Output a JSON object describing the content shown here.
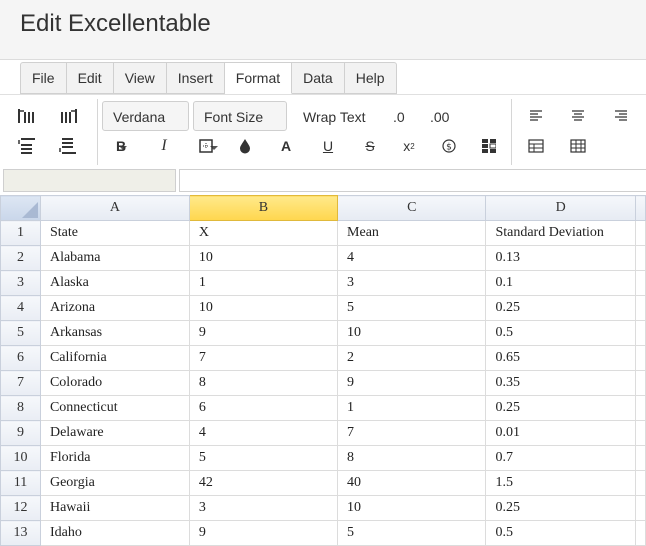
{
  "app": {
    "title": "Edit Excellentable"
  },
  "menu": {
    "items": [
      "File",
      "Edit",
      "View",
      "Insert",
      "Format",
      "Data",
      "Help"
    ],
    "active": "Format"
  },
  "toolbar": {
    "font_family": "Verdana",
    "font_size": "Font Size",
    "wrap_text": "Wrap Text",
    "decrease_decimal": ".0",
    "increase_decimal": ".00"
  },
  "formula_bar": {
    "cell_ref": "",
    "value": ""
  },
  "sheet": {
    "columns": [
      "A",
      "B",
      "C",
      "D"
    ],
    "selected_column": "B",
    "rows": [
      {
        "n": "1",
        "cells": [
          "State",
          "X",
          "Mean",
          "Standard Deviation"
        ]
      },
      {
        "n": "2",
        "cells": [
          "Alabama",
          "10",
          "4",
          "0.13"
        ]
      },
      {
        "n": "3",
        "cells": [
          "Alaska",
          "1",
          "3",
          "0.1"
        ]
      },
      {
        "n": "4",
        "cells": [
          "Arizona",
          "10",
          "5",
          "0.25"
        ]
      },
      {
        "n": "5",
        "cells": [
          "Arkansas",
          "9",
          "10",
          "0.5"
        ]
      },
      {
        "n": "6",
        "cells": [
          "California",
          "7",
          "2",
          "0.65"
        ]
      },
      {
        "n": "7",
        "cells": [
          "Colorado",
          "8",
          "9",
          "0.35"
        ]
      },
      {
        "n": "8",
        "cells": [
          "Connecticut",
          "6",
          "1",
          "0.25"
        ]
      },
      {
        "n": "9",
        "cells": [
          "Delaware",
          "4",
          "7",
          "0.01"
        ]
      },
      {
        "n": "10",
        "cells": [
          "Florida",
          "5",
          "8",
          "0.7"
        ]
      },
      {
        "n": "11",
        "cells": [
          "Georgia",
          "42",
          "40",
          "1.5"
        ]
      },
      {
        "n": "12",
        "cells": [
          "Hawaii",
          "3",
          "10",
          "0.25"
        ]
      },
      {
        "n": "13",
        "cells": [
          "Idaho",
          "9",
          "5",
          "0.5"
        ]
      }
    ]
  },
  "colors": {
    "selected_header": "#ffd64e",
    "accent": "#333333"
  }
}
